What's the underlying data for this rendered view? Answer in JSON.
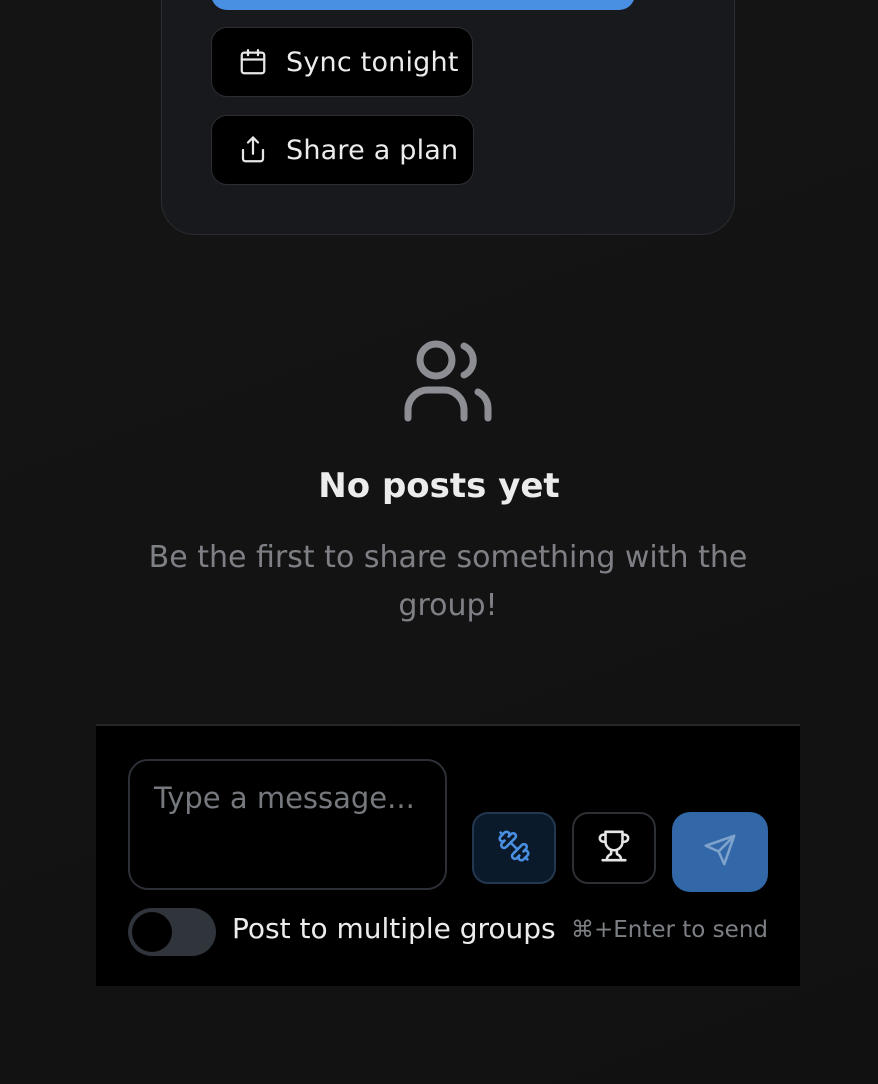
{
  "quick_actions": [
    {
      "label": "Sync tonight",
      "icon": "calendar-icon"
    },
    {
      "label": "Share a plan",
      "icon": "share-icon"
    }
  ],
  "empty_state": {
    "icon": "users-icon",
    "title": "No posts yet",
    "subtitle": "Be the first to share something with the group!"
  },
  "composer": {
    "placeholder": "Type a message...",
    "workout_button_icon": "dumbbell-icon",
    "challenge_button_icon": "trophy-icon",
    "send_button_icon": "send-icon",
    "toggle_label": "Post to multiple groups",
    "toggle_on": false,
    "hint": "⌘+Enter to send"
  },
  "colors": {
    "accent": "#4a90e2",
    "send_button": "#3268a7",
    "background": "#131313"
  }
}
